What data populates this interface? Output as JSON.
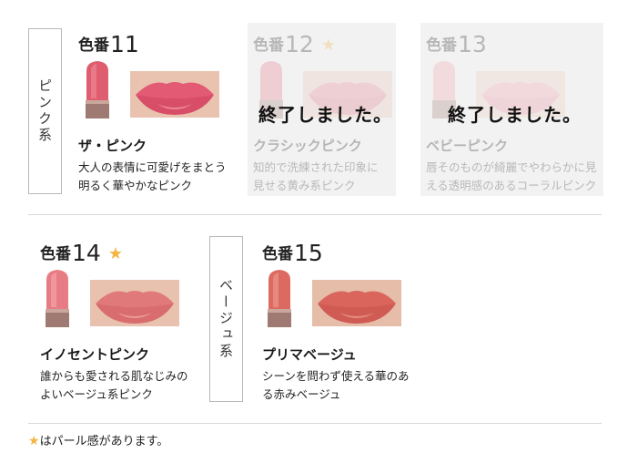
{
  "colors": {
    "star": "#f2b544",
    "bg_disabled": "#f2f2f2",
    "divider": "#d9d9d9"
  },
  "groups": {
    "pink_label": "ピンク系",
    "beige_label": "ベージュ系"
  },
  "products": [
    {
      "label": "色番",
      "number": "11",
      "star": "",
      "name": "ザ・ピンク",
      "desc": "大人の表情に可愛げをまとう\n明るく華やかなピンク",
      "ended_text": "",
      "available": true
    },
    {
      "label": "色番",
      "number": "12",
      "star": "★",
      "name": "クラシックピンク",
      "desc": "知的で洗練された印象に\n見せる黄み系ピンク",
      "ended_text": "終了しました。",
      "available": false
    },
    {
      "label": "色番",
      "number": "13",
      "star": "",
      "name": "ベビーピンク",
      "desc": "唇そのものが綺麗でやわらかに見\nえる透明感のあるコーラルピンク",
      "ended_text": "終了しました。",
      "available": false
    },
    {
      "label": "色番",
      "number": "14",
      "star": "★",
      "name": "イノセントピンク",
      "desc": "誰からも愛される肌なじみの\nよいベージュ系ピンク",
      "ended_text": "",
      "available": true
    },
    {
      "label": "色番",
      "number": "15",
      "star": "",
      "name": "プリマベージュ",
      "desc": "シーンを問わず使える華のあ\nる赤みベージュ",
      "ended_text": "",
      "available": true
    }
  ],
  "footnote": {
    "star": "★",
    "text": "はパール感があります。"
  }
}
